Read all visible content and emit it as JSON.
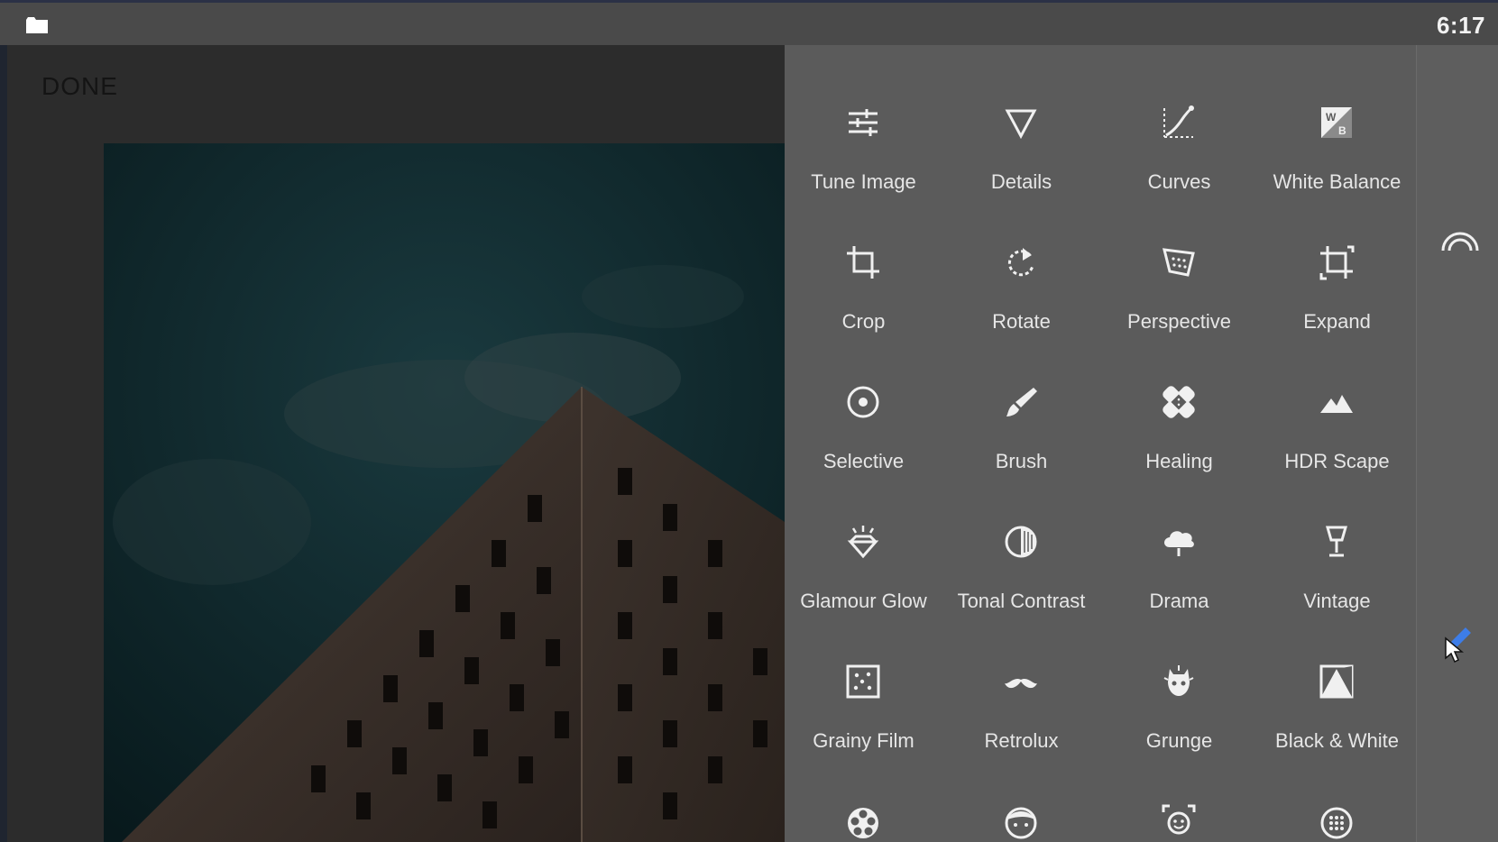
{
  "status_bar": {
    "time": "6:17",
    "folder_icon": "folder-icon"
  },
  "editor": {
    "done_label": "DONE"
  },
  "tools": [
    {
      "id": "tune-image",
      "label": "Tune Image",
      "icon": "sliders-icon"
    },
    {
      "id": "details",
      "label": "Details",
      "icon": "triangle-down-icon"
    },
    {
      "id": "curves",
      "label": "Curves",
      "icon": "curves-icon"
    },
    {
      "id": "white-balance",
      "label": "White Balance",
      "icon": "white-balance-icon"
    },
    {
      "id": "crop",
      "label": "Crop",
      "icon": "crop-icon"
    },
    {
      "id": "rotate",
      "label": "Rotate",
      "icon": "rotate-icon"
    },
    {
      "id": "perspective",
      "label": "Perspective",
      "icon": "perspective-icon"
    },
    {
      "id": "expand",
      "label": "Expand",
      "icon": "expand-icon"
    },
    {
      "id": "selective",
      "label": "Selective",
      "icon": "target-icon"
    },
    {
      "id": "brush",
      "label": "Brush",
      "icon": "brush-icon"
    },
    {
      "id": "healing",
      "label": "Healing",
      "icon": "bandage-icon"
    },
    {
      "id": "hdr-scape",
      "label": "HDR Scape",
      "icon": "mountain-icon"
    },
    {
      "id": "glamour-glow",
      "label": "Glamour Glow",
      "icon": "diamond-glow-icon"
    },
    {
      "id": "tonal-contrast",
      "label": "Tonal Contrast",
      "icon": "tonal-circle-icon"
    },
    {
      "id": "drama",
      "label": "Drama",
      "icon": "cloud-icon"
    },
    {
      "id": "vintage",
      "label": "Vintage",
      "icon": "lamp-icon"
    },
    {
      "id": "grainy-film",
      "label": "Grainy Film",
      "icon": "grain-icon"
    },
    {
      "id": "retrolux",
      "label": "Retrolux",
      "icon": "mustache-icon"
    },
    {
      "id": "grunge",
      "label": "Grunge",
      "icon": "grunge-icon"
    },
    {
      "id": "black-white",
      "label": "Black & White",
      "icon": "bw-photo-icon"
    },
    {
      "id": "noir",
      "label": "",
      "icon": "film-reel-icon"
    },
    {
      "id": "portrait",
      "label": "",
      "icon": "face-icon"
    },
    {
      "id": "head-pose",
      "label": "",
      "icon": "face-scan-icon"
    },
    {
      "id": "lens-blur",
      "label": "",
      "icon": "lens-dots-icon"
    }
  ],
  "right_strip": {
    "top_icon": "looks-rainbow-icon",
    "bottom_icon": "pencil-edit-icon"
  },
  "colors": {
    "panel_bg": "#5b5b5b",
    "icon": "#f0f0f0",
    "accent": "#3d7de8",
    "status_bg": "#4a4a4a"
  }
}
